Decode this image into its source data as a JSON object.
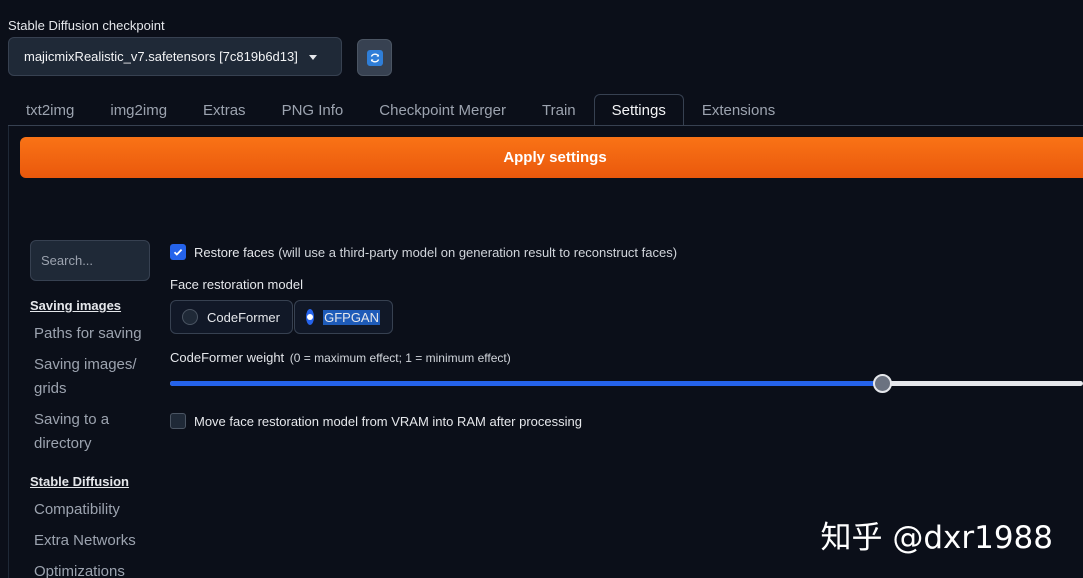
{
  "checkpoint": {
    "label": "Stable Diffusion checkpoint",
    "value": "majicmixRealistic_v7.safetensors [7c819b6d13]"
  },
  "tabs": [
    {
      "label": "txt2img"
    },
    {
      "label": "img2img"
    },
    {
      "label": "Extras"
    },
    {
      "label": "PNG Info"
    },
    {
      "label": "Checkpoint Merger"
    },
    {
      "label": "Train"
    },
    {
      "label": "Settings",
      "active": true
    },
    {
      "label": "Extensions"
    }
  ],
  "apply_button": "Apply settings",
  "search": {
    "placeholder": "Search..."
  },
  "nav": {
    "section1": "Saving images",
    "section1_items": [
      "Paths for saving",
      "Saving images/ grids",
      "Saving to a directory"
    ],
    "section2": "Stable Diffusion",
    "section2_items": [
      "Compatibility",
      "Extra Networks",
      "Optimizations"
    ]
  },
  "settings": {
    "restore_faces": {
      "checked": true,
      "label": "Restore faces",
      "hint": "(will use a third-party model on generation result to reconstruct faces)"
    },
    "face_model": {
      "label": "Face restoration model",
      "options": [
        "CodeFormer",
        "GFPGAN"
      ],
      "selected": "GFPGAN"
    },
    "codeformer_weight": {
      "label": "CodeFormer weight",
      "hint": "(0 = maximum effect; 1 = minimum effect)",
      "value": 0.78
    },
    "move_to_ram": {
      "checked": false,
      "label": "Move face restoration model from VRAM into RAM after processing"
    }
  },
  "watermark": "知乎 @dxr1988",
  "colors": {
    "accent": "#2563eb",
    "apply": "#f97316",
    "background": "#0b0f19"
  }
}
